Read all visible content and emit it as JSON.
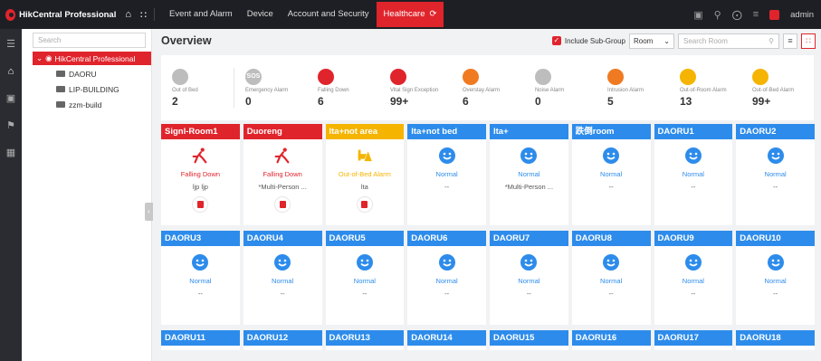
{
  "app": {
    "name": "HikCentral Professional",
    "user": "admin"
  },
  "nav": {
    "items": [
      "Event and Alarm",
      "Device",
      "Account and Security"
    ],
    "active": "Healthcare"
  },
  "tree": {
    "search_placeholder": "Search",
    "root": "HikCentral Professional",
    "nodes": [
      "DAORU",
      "LIP-BUILDING",
      "zzm-build"
    ]
  },
  "main": {
    "title": "Overview",
    "include_subgroup": "Include Sub-Group",
    "room_select": "Room",
    "search_placeholder": "Search Room"
  },
  "stats": [
    {
      "label": "Out of Bed",
      "value": "2",
      "color": "#bdbdbd",
      "icon": "bed-icon"
    },
    {
      "label": "Emergency Alarm",
      "value": "0",
      "color": "#bdbdbd",
      "icon": "sos-icon"
    },
    {
      "label": "Falling Down",
      "value": "6",
      "color": "#e0242c",
      "icon": "falling-icon"
    },
    {
      "label": "Vital Sign Exception",
      "value": "99+",
      "color": "#e0242c",
      "icon": "heart-icon"
    },
    {
      "label": "Overstay Alarm",
      "value": "6",
      "color": "#f07a22",
      "icon": "overstay-icon"
    },
    {
      "label": "Noise Alarm",
      "value": "0",
      "color": "#bdbdbd",
      "icon": "noise-icon"
    },
    {
      "label": "Intrusion Alarm",
      "value": "5",
      "color": "#f07a22",
      "icon": "intrusion-icon"
    },
    {
      "label": "Out-of-Room Alarm",
      "value": "13",
      "color": "#f5b400",
      "icon": "house-icon"
    },
    {
      "label": "Out-of-Bed Alarm",
      "value": "99+",
      "color": "#f5b400",
      "icon": "outbed-icon"
    }
  ],
  "rooms_row1": [
    {
      "name": "Signl-Room1",
      "head_color": "#e0242c",
      "status": "Falling Down",
      "status_color": "#e0242c",
      "sub": "ljp ljp",
      "bed": true,
      "icon": "falling-person-icon"
    },
    {
      "name": "Duoreng",
      "head_color": "#e0242c",
      "status": "Falling Down",
      "status_color": "#e0242c",
      "sub": "*Multi-Person ...",
      "bed": true,
      "icon": "falling-person-icon"
    },
    {
      "name": "lta+not area",
      "head_color": "#f5b400",
      "status": "Out-of-Bed Alarm",
      "status_color": "#f5b400",
      "sub": "lta",
      "bed": true,
      "icon": "out-of-bed-icon"
    },
    {
      "name": "lta+not bed",
      "head_color": "#2d8ceb",
      "status": "Normal",
      "status_color": "#2d8ceb",
      "sub": "--",
      "bed": false,
      "icon": "smile-icon"
    },
    {
      "name": "lta+",
      "head_color": "#2d8ceb",
      "status": "Normal",
      "status_color": "#2d8ceb",
      "sub": "*Multi-Person ...",
      "bed": false,
      "icon": "smile-icon"
    },
    {
      "name": "跌倒room",
      "head_color": "#2d8ceb",
      "status": "Normal",
      "status_color": "#2d8ceb",
      "sub": "--",
      "bed": false,
      "icon": "smile-icon"
    },
    {
      "name": "DAORU1",
      "head_color": "#2d8ceb",
      "status": "Normal",
      "status_color": "#2d8ceb",
      "sub": "--",
      "bed": false,
      "icon": "smile-icon"
    },
    {
      "name": "DAORU2",
      "head_color": "#2d8ceb",
      "status": "Normal",
      "status_color": "#2d8ceb",
      "sub": "--",
      "bed": false,
      "icon": "smile-icon"
    }
  ],
  "rooms_row2": [
    {
      "name": "DAORU3",
      "status": "Normal",
      "sub": "--"
    },
    {
      "name": "DAORU4",
      "status": "Normal",
      "sub": "--"
    },
    {
      "name": "DAORU5",
      "status": "Normal",
      "sub": "--"
    },
    {
      "name": "DAORU6",
      "status": "Normal",
      "sub": "--"
    },
    {
      "name": "DAORU7",
      "status": "Normal",
      "sub": "--"
    },
    {
      "name": "DAORU8",
      "status": "Normal",
      "sub": "--"
    },
    {
      "name": "DAORU9",
      "status": "Normal",
      "sub": "--"
    },
    {
      "name": "DAORU10",
      "status": "Normal",
      "sub": "--"
    }
  ],
  "rooms_row3": [
    "DAORU11",
    "DAORU12",
    "DAORU13",
    "DAORU14",
    "DAORU15",
    "DAORU16",
    "DAORU17",
    "DAORU18"
  ],
  "colors": {
    "accent": "#e0242c",
    "normal": "#2d8ceb"
  }
}
